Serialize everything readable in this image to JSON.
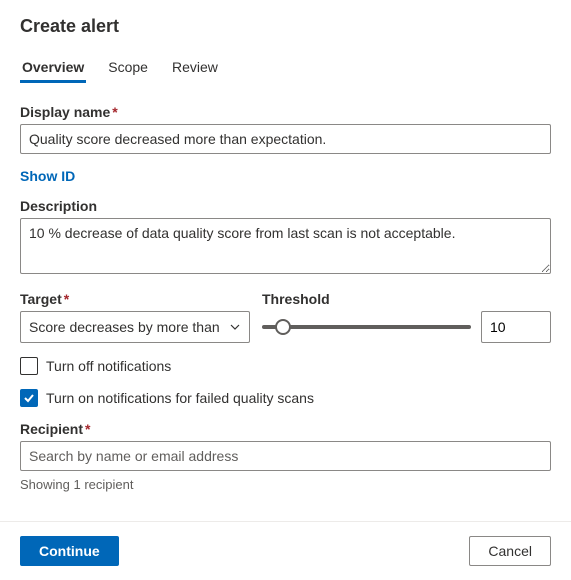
{
  "page": {
    "title": "Create alert"
  },
  "tabs": [
    {
      "label": "Overview",
      "active": true
    },
    {
      "label": "Scope",
      "active": false
    },
    {
      "label": "Review",
      "active": false
    }
  ],
  "fields": {
    "displayName": {
      "label": "Display name",
      "value": "Quality score decreased more than expectation."
    },
    "showIdLink": "Show ID",
    "description": {
      "label": "Description",
      "value": "10 % decrease of data quality score from last scan is not acceptable."
    },
    "target": {
      "label": "Target",
      "selected": "Score decreases by more than"
    },
    "threshold": {
      "label": "Threshold",
      "value": "10",
      "sliderPercent": 10
    },
    "turnOffNotifications": {
      "label": "Turn off notifications",
      "checked": false
    },
    "turnOnFailedScans": {
      "label": "Turn on notifications for failed quality scans",
      "checked": true
    },
    "recipient": {
      "label": "Recipient",
      "placeholder": "Search by name or email address",
      "hint": "Showing 1 recipient"
    }
  },
  "footer": {
    "primary": "Continue",
    "secondary": "Cancel"
  }
}
